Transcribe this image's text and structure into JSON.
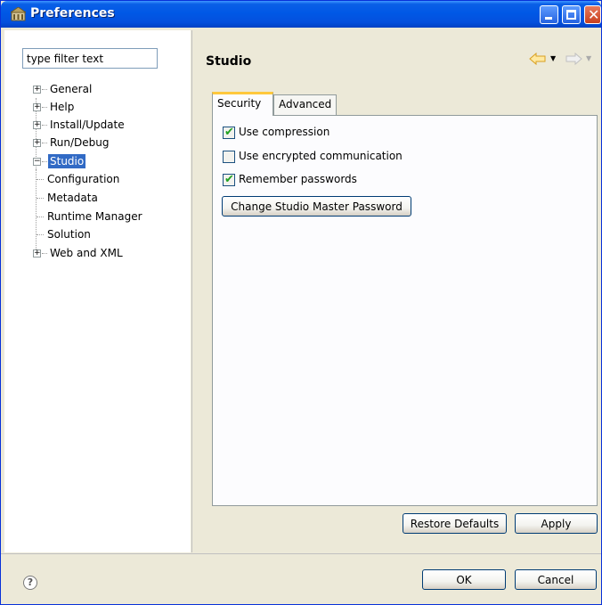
{
  "window": {
    "title": "Preferences"
  },
  "filter": {
    "placeholder": "type filter text"
  },
  "tree": {
    "general": "General",
    "help": "Help",
    "install_update": "Install/Update",
    "run_debug": "Run/Debug",
    "studio": "Studio",
    "configuration": "Configuration",
    "metadata": "Metadata",
    "runtime_manager": "Runtime Manager",
    "solution": "Solution",
    "web_and_xml": "Web and XML",
    "selected": "Studio"
  },
  "page": {
    "title": "Studio",
    "tabs": {
      "security": "Security",
      "advanced": "Advanced",
      "active": "Security"
    },
    "options": {
      "use_compression": {
        "label": "Use compression",
        "checked": true
      },
      "use_encrypted": {
        "label": "Use encrypted communication",
        "checked": false
      },
      "remember_passwords": {
        "label": "Remember passwords",
        "checked": true
      }
    },
    "change_password_label": "Change Studio Master Password",
    "restore_defaults_label": "Restore Defaults",
    "apply_label": "Apply"
  },
  "footer": {
    "ok_label": "OK",
    "cancel_label": "Cancel"
  },
  "icons": {
    "title": "preferences-icon",
    "back": "back-arrow-icon",
    "forward": "forward-arrow-icon",
    "help": "help-icon"
  },
  "colors": {
    "titlebar": "#0058e6",
    "selection": "#316ac5",
    "active_tab_accent": "#ffc83c",
    "check_mark": "#21a121"
  }
}
